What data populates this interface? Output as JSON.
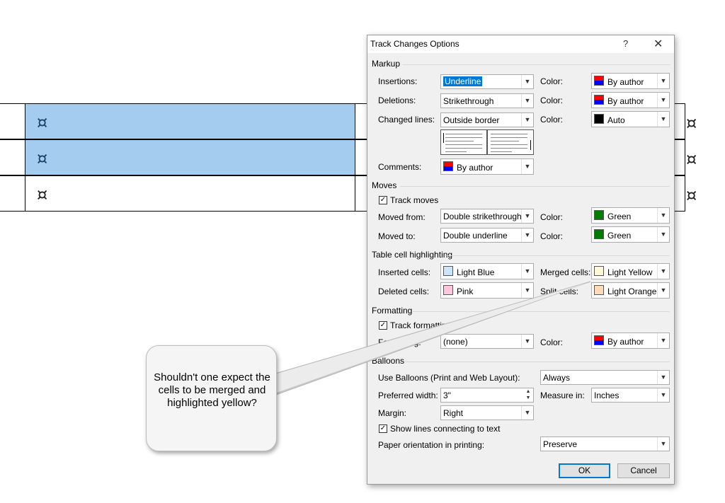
{
  "document": {
    "rows": [
      {
        "mark": "¤",
        "highlighted": true
      },
      {
        "mark": "¤",
        "highlighted": true
      },
      {
        "mark": "¤",
        "highlighted": false
      }
    ],
    "highlight_color": "#a3ccef"
  },
  "dialog": {
    "title": "Track Changes Options",
    "help_icon": "?",
    "close_icon": "✕",
    "markup": {
      "section": "Markup",
      "insertions_label": "Insertions:",
      "insertions_value": "Underline",
      "insertions_color_label": "Color:",
      "insertions_color": "By author",
      "deletions_label": "Deletions:",
      "deletions_value": "Strikethrough",
      "deletions_color_label": "Color:",
      "deletions_color": "By author",
      "changed_lines_label": "Changed lines:",
      "changed_lines_value": "Outside border",
      "changed_lines_color_label": "Color:",
      "changed_lines_color": "Auto",
      "comments_label": "Comments:",
      "comments_color": "By author"
    },
    "moves": {
      "section": "Moves",
      "track_moves_label": "Track moves",
      "track_moves_checked": true,
      "moved_from_label": "Moved from:",
      "moved_from_value": "Double strikethrough",
      "moved_from_color_label": "Color:",
      "moved_from_color": "Green",
      "moved_to_label": "Moved to:",
      "moved_to_value": "Double underline",
      "moved_to_color_label": "Color:",
      "moved_to_color": "Green"
    },
    "table_cells": {
      "section": "Table cell highlighting",
      "inserted_label": "Inserted cells:",
      "inserted_value": "Light Blue",
      "merged_label": "Merged cells:",
      "merged_value": "Light Yellow",
      "deleted_label": "Deleted cells:",
      "deleted_value": "Pink",
      "split_label": "Split cells:",
      "split_value": "Light Orange",
      "colors": {
        "light_blue": "#cce4ff",
        "light_yellow": "#fff8d6",
        "pink": "#ffc8dc",
        "light_orange": "#ffdcb8",
        "green": "#007a00"
      }
    },
    "formatting": {
      "section": "Formatting",
      "track_formatting_label": "Track formatting",
      "track_formatting_checked": true,
      "formatting_label": "Formatting:",
      "formatting_value": "(none)",
      "formatting_color_label": "Color:",
      "formatting_color": "By author"
    },
    "balloons": {
      "section": "Balloons",
      "use_balloons_label": "Use Balloons (Print and Web Layout):",
      "use_balloons_value": "Always",
      "preferred_width_label": "Preferred width:",
      "preferred_width_value": "3\"",
      "measure_in_label": "Measure in:",
      "measure_in_value": "Inches",
      "margin_label": "Margin:",
      "margin_value": "Right",
      "show_lines_label": "Show lines connecting to text",
      "show_lines_checked": true,
      "paper_orientation_label": "Paper orientation in printing:",
      "paper_orientation_value": "Preserve"
    },
    "ok_label": "OK",
    "cancel_label": "Cancel"
  },
  "callout": {
    "text": "Shouldn't one expect the cells to be merged and highlighted yellow?"
  }
}
